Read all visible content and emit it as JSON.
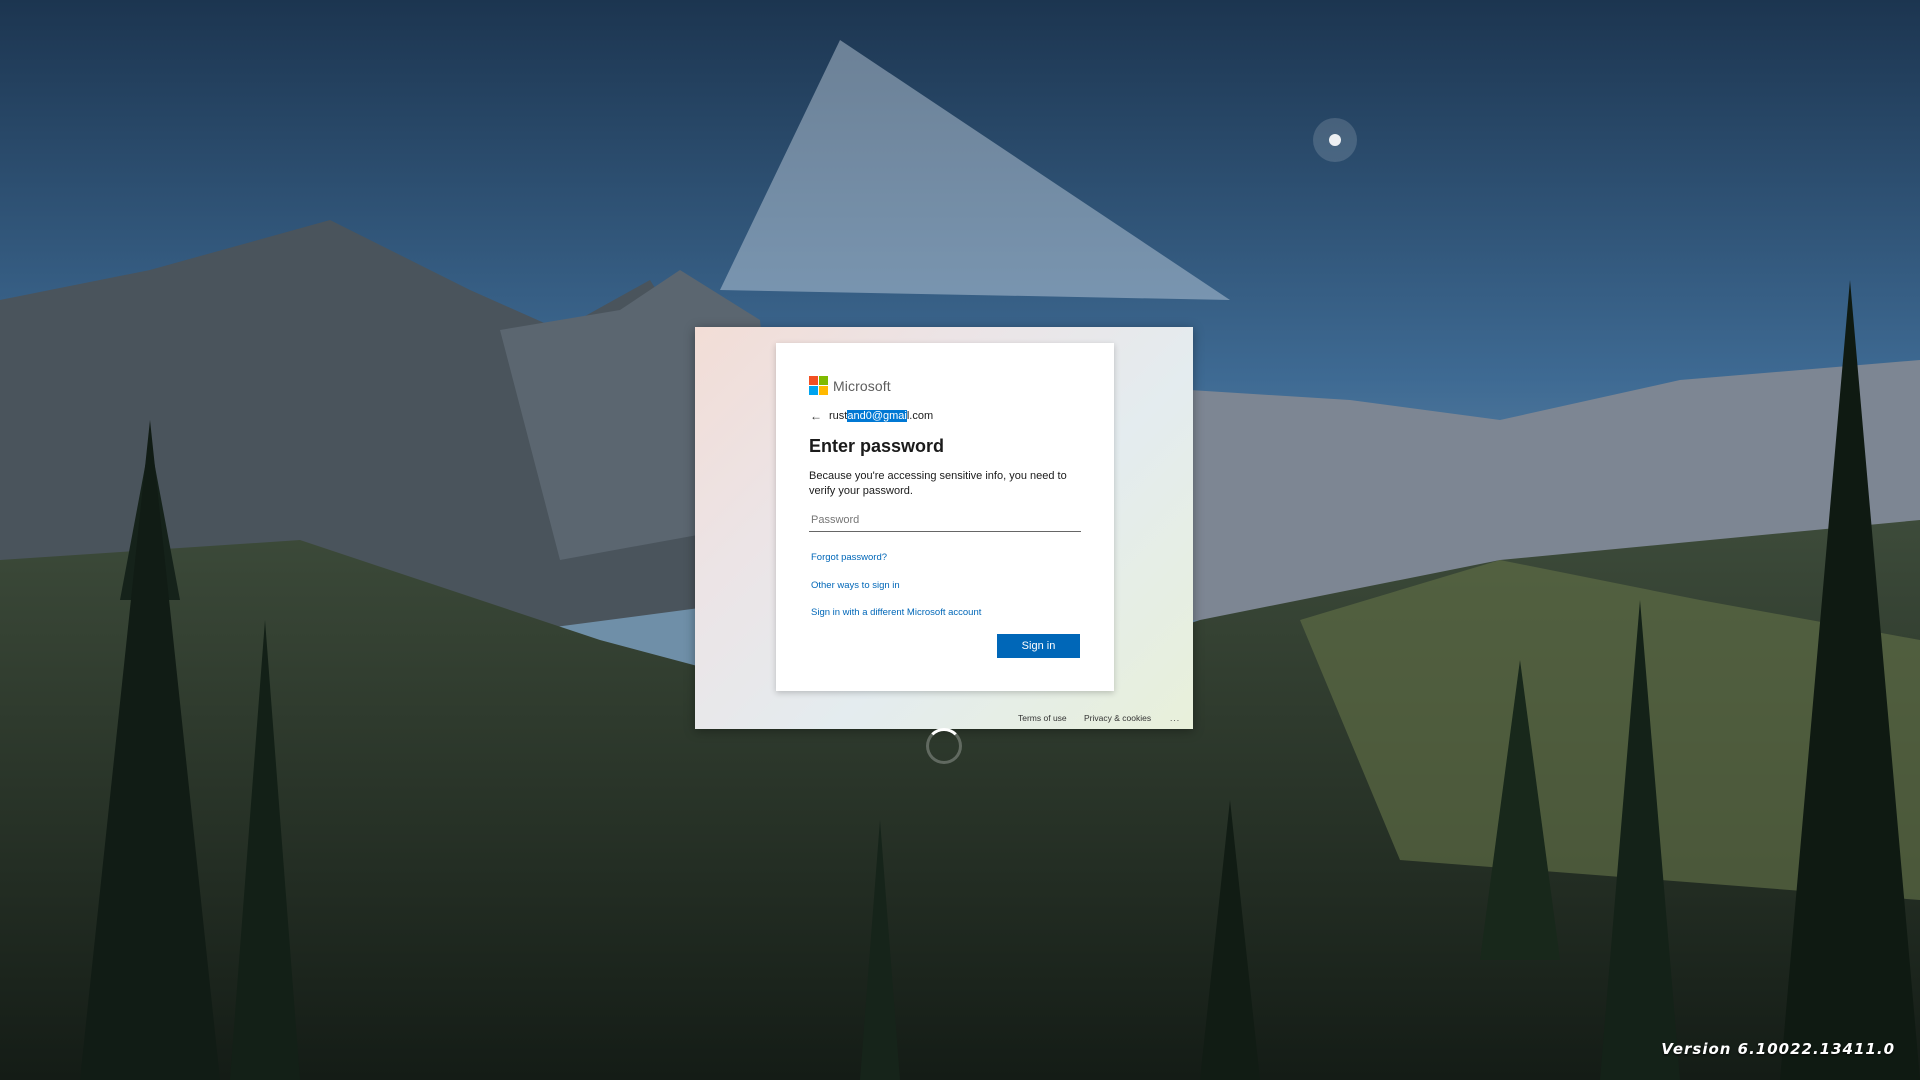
{
  "background": {
    "description_icon": "mountain-forest-wallpaper-icon",
    "colors": {
      "sky_top": "#1c3550",
      "sky_mid": "#4a7aa4",
      "mountain": "#3c4a55",
      "forest": "#1a2a20"
    }
  },
  "signin": {
    "brand": "Microsoft",
    "brand_colors": [
      "#f25022",
      "#7fba00",
      "#00a4ef",
      "#ffb900"
    ],
    "email_prefix": "rust",
    "email_selected": "and0@gmai",
    "email_suffix": "l.com",
    "title": "Enter password",
    "description": "Because you're accessing sensitive info, you need to verify your password.",
    "password_placeholder": "Password",
    "password_value": "",
    "link_forgot": "Forgot password?",
    "link_other_ways": "Other ways to sign in",
    "link_different_account": "Sign in with a different Microsoft account",
    "signin_button": "Sign in",
    "accent_color": "#0067b8"
  },
  "footer": {
    "terms": "Terms of use",
    "privacy": "Privacy & cookies",
    "more": "..."
  },
  "version_text": "Version 6.10022.13411.0"
}
